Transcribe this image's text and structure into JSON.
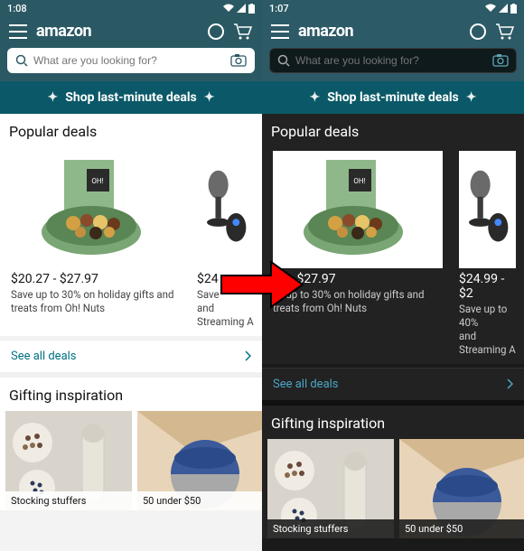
{
  "left": {
    "status_time": "1:08",
    "logo": "amazon",
    "search_placeholder": "What are you looking for?",
    "banner": "Shop last-minute deals",
    "section1_title": "Popular deals",
    "deal1_price": "$20.27 - $27.97",
    "deal1_desc": "Save up to 30% on holiday gifts and treats from Oh! Nuts",
    "deal2_price": "$24",
    "deal2_desc": "Save\nand Streaming A",
    "see_all": "See all deals",
    "section2_title": "Gifting inspiration",
    "gift1_label": "Stocking stuffers",
    "gift2_label": "50 under $50"
  },
  "right": {
    "status_time": "1:07",
    "logo": "amazon",
    "search_placeholder": "What are you looking for?",
    "banner": "Shop last-minute deals",
    "section1_title": "Popular deals",
    "deal1_price": "27 - $27.97",
    "deal1_desc": "ve up to 30% on holiday gifts and treats from Oh! Nuts",
    "deal2_price": "$24.99 - $2",
    "deal2_desc": "Save up to 40%\nand Streaming A",
    "see_all": "See all deals",
    "section2_title": "Gifting inspiration",
    "gift1_label": "Stocking stuffers",
    "gift2_label": "50 under $50"
  }
}
